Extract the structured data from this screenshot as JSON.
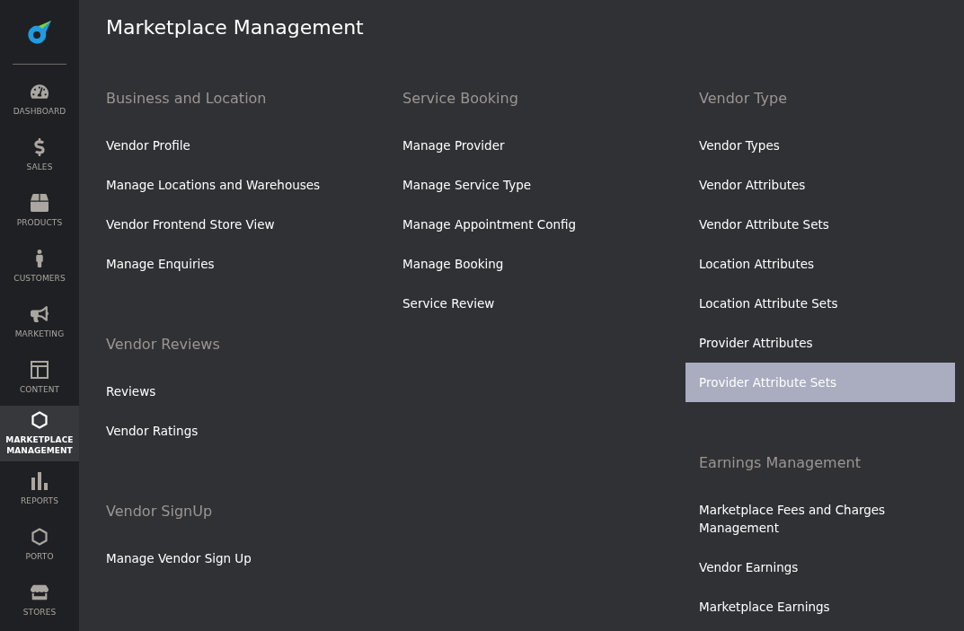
{
  "sidebar": {
    "items": [
      {
        "kind": "dashboard",
        "label": "DASHBOARD",
        "selected": false
      },
      {
        "kind": "sales",
        "label": "SALES",
        "selected": false
      },
      {
        "kind": "products",
        "label": "PRODUCTS",
        "selected": false
      },
      {
        "kind": "customers",
        "label": "CUSTOMERS",
        "selected": false
      },
      {
        "kind": "marketing",
        "label": "MARKETING",
        "selected": false
      },
      {
        "kind": "content",
        "label": "CONTENT",
        "selected": false
      },
      {
        "kind": "hexagon",
        "label": "MARKETPLACE MANAGEMENT",
        "selected": true
      },
      {
        "kind": "reports",
        "label": "REPORTS",
        "selected": false
      },
      {
        "kind": "hexagon",
        "label": "PORTO",
        "selected": false
      },
      {
        "kind": "stores",
        "label": "STORES",
        "selected": false
      }
    ]
  },
  "page": {
    "title": "Marketplace Management"
  },
  "columns": [
    [
      {
        "heading": "Business and Location",
        "links": [
          {
            "label": "Vendor Profile",
            "selected": false
          },
          {
            "label": "Manage Locations and Warehouses",
            "selected": false
          },
          {
            "label": "Vendor Frontend Store View",
            "selected": false
          },
          {
            "label": "Manage Enquiries",
            "selected": false
          }
        ]
      },
      {
        "heading": "Vendor Reviews",
        "links": [
          {
            "label": "Reviews",
            "selected": false
          },
          {
            "label": "Vendor Ratings",
            "selected": false
          }
        ]
      },
      {
        "heading": "Vendor SignUp",
        "links": [
          {
            "label": "Manage Vendor Sign Up",
            "selected": false
          }
        ]
      }
    ],
    [
      {
        "heading": "Service Booking",
        "links": [
          {
            "label": "Manage Provider",
            "selected": false
          },
          {
            "label": "Manage Service Type",
            "selected": false
          },
          {
            "label": "Manage Appointment Config",
            "selected": false
          },
          {
            "label": "Manage Booking",
            "selected": false
          },
          {
            "label": "Service Review",
            "selected": false
          }
        ]
      }
    ],
    [
      {
        "heading": "Vendor Type",
        "links": [
          {
            "label": "Vendor Types",
            "selected": false
          },
          {
            "label": "Vendor Attributes",
            "selected": false
          },
          {
            "label": "Vendor Attribute Sets",
            "selected": false
          },
          {
            "label": "Location Attributes",
            "selected": false
          },
          {
            "label": "Location Attribute Sets",
            "selected": false
          },
          {
            "label": "Provider Attributes",
            "selected": false
          },
          {
            "label": "Provider Attribute Sets",
            "selected": true
          }
        ]
      },
      {
        "heading": "Earnings Management",
        "links": [
          {
            "label": "Marketplace Fees and Charges Management",
            "selected": false
          },
          {
            "label": "Vendor Earnings",
            "selected": false
          },
          {
            "label": "Marketplace Earnings",
            "selected": false
          }
        ]
      }
    ]
  ]
}
